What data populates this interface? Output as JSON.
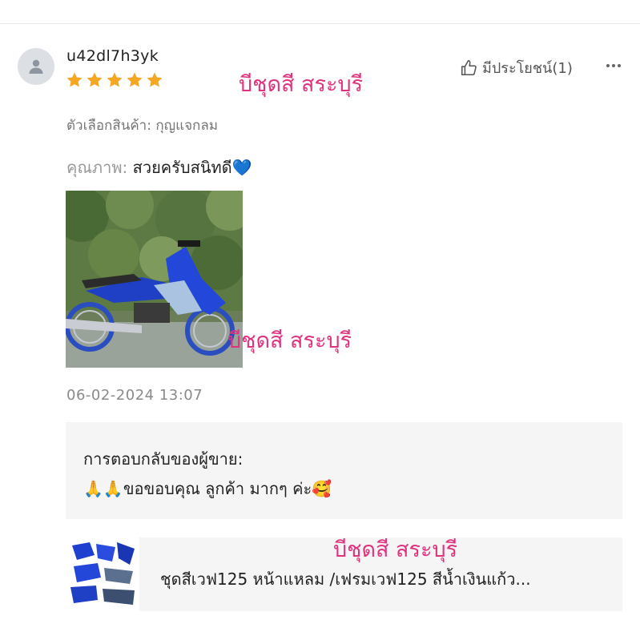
{
  "review": {
    "username": "u42dl7h3yk",
    "rating": 5,
    "helpful_label": "มีประโยชน์(1)",
    "variant_text": "ตัวเลือกสินค้า: กุญแจกลม",
    "quality_label": "คุณภาพ:",
    "quality_value": "สวยครับสนิทดี",
    "quality_emoji": "💙",
    "date": "06-02-2024 13:07"
  },
  "watermarks": {
    "text1": "บีชุดสี สระบุรี",
    "text2": "บีชุดสี สระบุรี",
    "text3": "บีชุดสี สระบุรี"
  },
  "seller_reply": {
    "title": "การตอบกลับของผู้ขาย:",
    "emoji_prefix": "🙏🙏",
    "body": "ขอขอบคุณ ลูกค้า มากๆ ค่ะ",
    "emoji_suffix": "🥰"
  },
  "product": {
    "name": "ชุดสีเวฟ125 หน้าแหลม /เฟรมเวฟ125 สีน้ำเงินแก้ว..."
  },
  "icons": {
    "avatar": "user-avatar-icon",
    "star": "star-icon",
    "thumbs_up": "thumbs-up-icon",
    "more": "more-dots-icon"
  },
  "colors": {
    "star": "#f5a623",
    "watermark": "#e0337e",
    "reply_bg": "#f5f5f5"
  }
}
